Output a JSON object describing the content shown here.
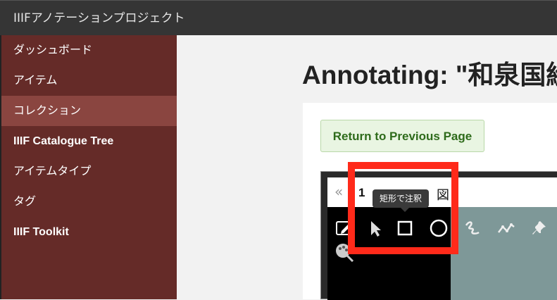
{
  "header": {
    "title": "IIIFアノテーションプロジェクト"
  },
  "sidebar": {
    "items": [
      {
        "label": "ダッシュボード"
      },
      {
        "label": "アイテム"
      },
      {
        "label": "コレクション"
      },
      {
        "label": "IIIF Catalogue Tree"
      },
      {
        "label": "アイテムタイプ"
      },
      {
        "label": "タグ"
      },
      {
        "label": "IIIF Toolkit"
      }
    ],
    "active_index": 2
  },
  "main": {
    "title": "Annotating: \"和泉国絵",
    "return_button": "Return to Previous Page"
  },
  "viewer": {
    "collapse_glyph": "«",
    "canvas_number": "1",
    "canvas_title_tail": "図",
    "tooltip": "矩形で注釈",
    "tools": [
      {
        "icon": "edit-icon"
      },
      {
        "icon": "pointer-icon"
      },
      {
        "icon": "rectangle-icon"
      },
      {
        "icon": "ellipse-icon"
      },
      {
        "icon": "freehand-icon"
      },
      {
        "icon": "polyline-icon"
      },
      {
        "icon": "pin-icon"
      },
      {
        "icon": "palette-icon"
      }
    ]
  },
  "colors": {
    "topbar": "#353535",
    "sidebar": "#652b28",
    "sidebar_active": "#8a4540",
    "highlight": "#ff2a1a",
    "button_bg": "#e9f5e2",
    "button_text": "#2e6b1b"
  }
}
